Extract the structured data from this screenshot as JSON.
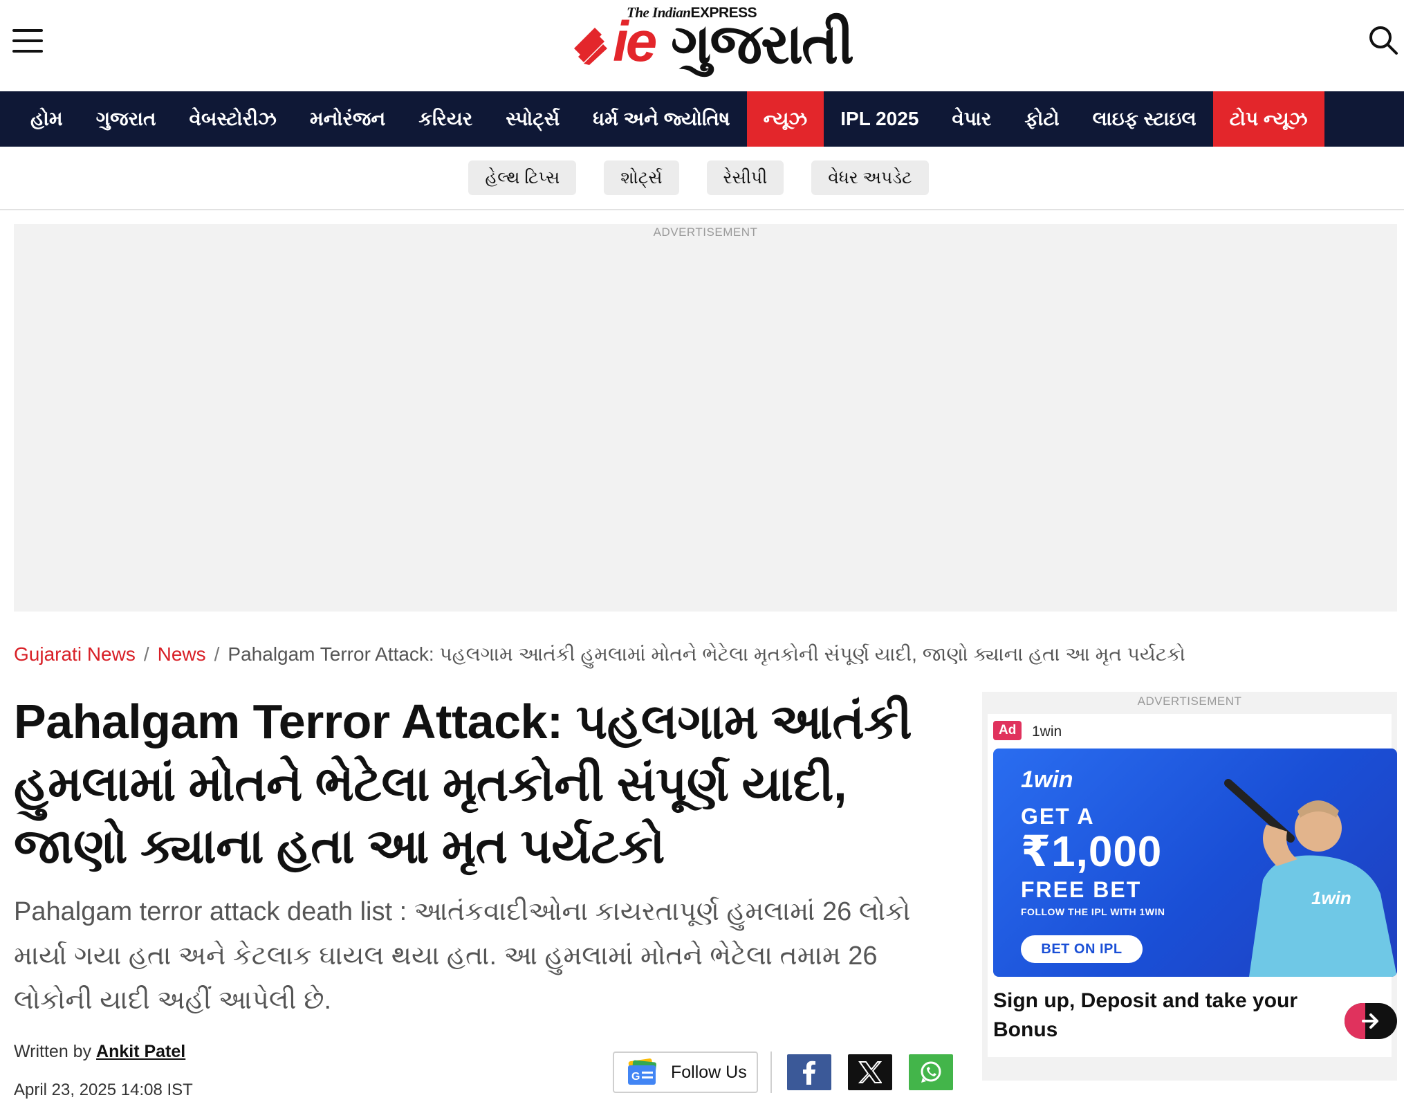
{
  "header": {
    "logo_top": "The Indian",
    "logo_top_bold": "EXPRESS",
    "logo_ie": "ie",
    "logo_name": "ગુજરાતી"
  },
  "nav": {
    "items": [
      {
        "label": "હોમ",
        "active": false
      },
      {
        "label": "ગુજરાત",
        "active": false
      },
      {
        "label": "વેબસ્ટોરીઝ",
        "active": false
      },
      {
        "label": "મનોરંજન",
        "active": false
      },
      {
        "label": "કરિયર",
        "active": false
      },
      {
        "label": "સ્પોર્ટ્સ",
        "active": false
      },
      {
        "label": "ધર્મ અને જ્યોતિષ",
        "active": false
      },
      {
        "label": "ન્યૂઝ",
        "active": true
      },
      {
        "label": "IPL 2025",
        "active": false
      },
      {
        "label": "વેપાર",
        "active": false
      },
      {
        "label": "ફોટો",
        "active": false
      },
      {
        "label": "લાઇફ સ્ટાઇલ",
        "active": false
      },
      {
        "label": "ટોપ ન્યૂઝ",
        "active": true
      }
    ],
    "active_color": "#e3262b",
    "bar_color": "#0f1836"
  },
  "subnav": {
    "chips": [
      "હેલ્થ ટિપ્સ",
      "શોર્ટ્સ",
      "રેસીપી",
      "વેધર અપડેટ"
    ]
  },
  "ads": {
    "label": "ADVERTISEMENT",
    "side": {
      "badge": "Ad",
      "advertiser": "1win",
      "banner_logo": "1win",
      "banner_get": "GET A",
      "banner_amount": "₹1,000",
      "banner_free": "FREE BET",
      "banner_follow": "FOLLOW THE IPL WITH 1WIN",
      "banner_button": "BET ON IPL",
      "cta_text": "Sign up, Deposit and take your Bonus"
    }
  },
  "breadcrumb": {
    "home": "Gujarati News",
    "section": "News",
    "current": "Pahalgam Terror Attack: પહલગામ આતંકી હુમલામાં મોતને ભેટેલા મૃતકોની સંપૂર્ણ યાદી, જાણો ક્યાના હતા આ મૃત પર્યટકો",
    "separator": "/"
  },
  "article": {
    "headline": "Pahalgam Terror Attack: પહલગામ આતંકી હુમલામાં મોતને ભેટેલા મૃતકોની સંપૂર્ણ યાદી, જાણો ક્યાના હતા આ મૃત પર્યટકો",
    "summary": "Pahalgam terror attack death list : આતંકવાદીઓના કાયરતાપૂર્ણ હુમલામાં 26 લોકો માર્યા ગયા હતા અને કેટલાક ઘાયલ થયા હતા. આ હુમલામાં મોતને ભેટેલા તમામ 26 લોકોની યાદી અહીં આપેલી છે.",
    "written_by": "Written by",
    "author": "Ankit Patel",
    "date": "April 23, 2025 14:08 IST"
  },
  "share": {
    "follow_label": "Follow Us",
    "facebook_color": "#3b5998",
    "x_color": "#111111",
    "whatsapp_color": "#43b54a"
  }
}
